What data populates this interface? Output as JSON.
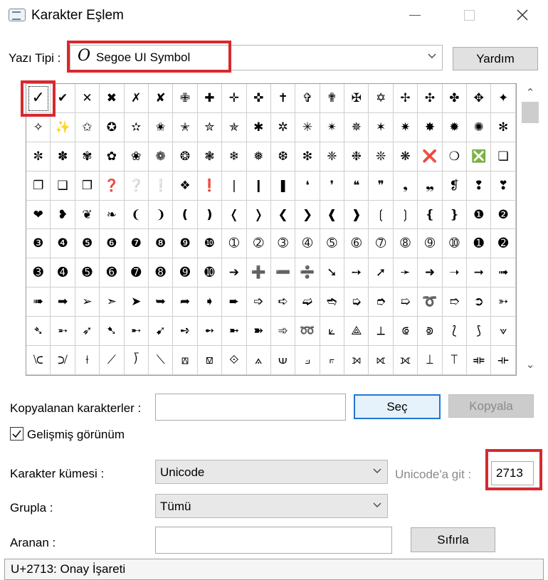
{
  "window": {
    "title": "Karakter Eşlem"
  },
  "font": {
    "label": "Yazı Tipi :",
    "value": "Segoe UI Symbol",
    "glyph": "O",
    "help_label": "Yardım"
  },
  "grid": {
    "rows": [
      [
        "✓",
        "✔",
        "✕",
        "✖",
        "✗",
        "✘",
        "✙",
        "✚",
        "✛",
        "✜",
        "✝",
        "✞",
        "✟",
        "✠",
        "✡",
        "✢",
        "✣",
        "✤",
        "✥",
        "✦"
      ],
      [
        "✧",
        "✨",
        "✩",
        "✪",
        "✫",
        "✬",
        "✭",
        "✮",
        "✯",
        "✱",
        "✲",
        "✳",
        "✴",
        "✵",
        "✶",
        "✷",
        "✸",
        "✹",
        "✺",
        "✻"
      ],
      [
        "✼",
        "✽",
        "✾",
        "✿",
        "❀",
        "❁",
        "❂",
        "❃",
        "❄",
        "❅",
        "❆",
        "❇",
        "❈",
        "❉",
        "❊",
        "❋",
        "❌",
        "❍",
        "❎",
        "❏"
      ],
      [
        "❐",
        "❑",
        "❒",
        "❓",
        "❔",
        "❕",
        "❖",
        "❗",
        "❘",
        "❙",
        "❚",
        "❛",
        "❜",
        "❝",
        "❞",
        "❟",
        "❠",
        "❡",
        "❢",
        "❣"
      ],
      [
        "❤",
        "❥",
        "❦",
        "❧",
        "❨",
        "❩",
        "❪",
        "❫",
        "❬",
        "❭",
        "❮",
        "❯",
        "❰",
        "❱",
        "❲",
        "❳",
        "❴",
        "❵",
        "❶",
        "❷"
      ],
      [
        "❸",
        "❹",
        "❺",
        "❻",
        "❼",
        "❽",
        "❾",
        "❿",
        "➀",
        "➁",
        "➂",
        "➃",
        "➄",
        "➅",
        "➆",
        "➇",
        "➈",
        "➉",
        "➊",
        "➋"
      ],
      [
        "➌",
        "➍",
        "➎",
        "➏",
        "➐",
        "➑",
        "➒",
        "➓",
        "➔",
        "➕",
        "➖",
        "➗",
        "➘",
        "➙",
        "➚",
        "➛",
        "➜",
        "➝",
        "➞",
        "➟"
      ],
      [
        "➠",
        "➡",
        "➢",
        "➣",
        "➤",
        "➥",
        "➦",
        "➧",
        "➨",
        "➩",
        "➪",
        "➫",
        "➬",
        "➭",
        "➮",
        "➯",
        "➰",
        "➱",
        "➲",
        "➳"
      ],
      [
        "➴",
        "➵",
        "➶",
        "➷",
        "➸",
        "➹",
        "➺",
        "➻",
        "➼",
        "➽",
        "➾",
        "➿",
        "⟀",
        "⟁",
        "⟂",
        "⟃",
        "⟄",
        "⟅",
        "⟆",
        "⟇"
      ],
      [
        "⟈",
        "⟉",
        "⟊",
        "⟋",
        "⟌",
        "⟍",
        "⟎",
        "⟏",
        "⟐",
        "⟑",
        "⟒",
        "⟓",
        "⟔",
        "⟕",
        "⟖",
        "⟗",
        "⟘",
        "⟙",
        "⟚",
        "⟛"
      ]
    ]
  },
  "copied": {
    "label": "Kopyalanan karakterler :",
    "value": "",
    "select_label": "Seç",
    "copy_label": "Kopyala"
  },
  "advanced": {
    "label": "Gelişmiş görünüm",
    "checked": true
  },
  "charset": {
    "label": "Karakter kümesi :",
    "value": "Unicode",
    "goto_label": "Unicode'a git :",
    "goto_value": "2713"
  },
  "group": {
    "label": "Grupla :",
    "value": "Tümü"
  },
  "search": {
    "label": "Aranan :",
    "value": "",
    "reset_label": "Sıfırla"
  },
  "status": {
    "text": "U+2713: Onay İşareti"
  }
}
